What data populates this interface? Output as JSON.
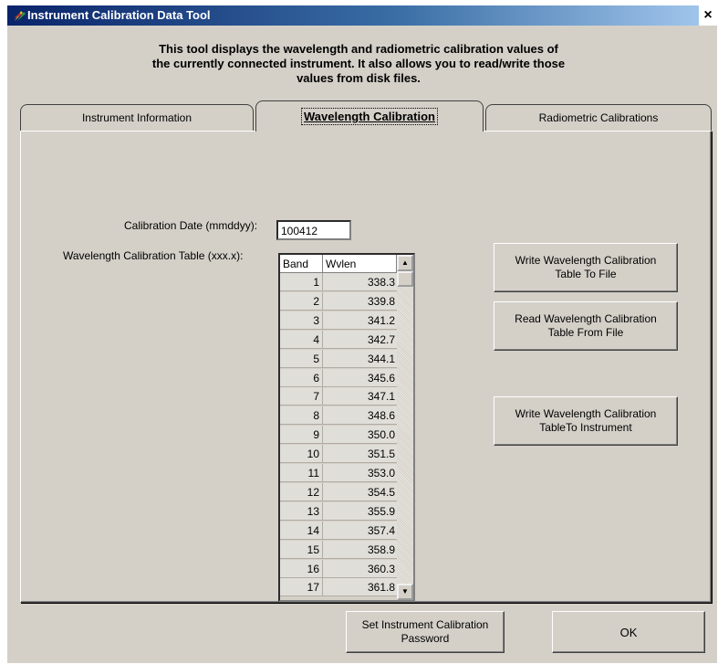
{
  "window": {
    "title": "Instrument Calibration Data Tool",
    "close_glyph": "×"
  },
  "intro": {
    "line1": "This tool displays the wavelength and radiometric calibration values of",
    "line2": "the currently connected instrument. It also allows you to read/write those",
    "line3": "values from disk files."
  },
  "tabs": [
    {
      "label": "Instrument Information",
      "selected": false
    },
    {
      "label": "Wavelength Calibration",
      "selected": true
    },
    {
      "label": "Radiometric Calibrations",
      "selected": false
    }
  ],
  "form": {
    "date_label": "Calibration Date (mmddyy):",
    "date_value": "100412",
    "table_label": "Wavelength Calibration Table (xxx.x):"
  },
  "table": {
    "headers": [
      "Band",
      "Wvlen"
    ],
    "rows": [
      [
        "1",
        "338.3"
      ],
      [
        "2",
        "339.8"
      ],
      [
        "3",
        "341.2"
      ],
      [
        "4",
        "342.7"
      ],
      [
        "5",
        "344.1"
      ],
      [
        "6",
        "345.6"
      ],
      [
        "7",
        "347.1"
      ],
      [
        "8",
        "348.6"
      ],
      [
        "9",
        "350.0"
      ],
      [
        "10",
        "351.5"
      ],
      [
        "11",
        "353.0"
      ],
      [
        "12",
        "354.5"
      ],
      [
        "13",
        "355.9"
      ],
      [
        "14",
        "357.4"
      ],
      [
        "15",
        "358.9"
      ],
      [
        "16",
        "360.3"
      ],
      [
        "17",
        "361.8"
      ]
    ]
  },
  "buttons": {
    "write_file": [
      "Write Wavelength Calibration",
      "Table To File"
    ],
    "read_file": [
      "Read Wavelength Calibration",
      "Table From File"
    ],
    "write_instrument": [
      "Write Wavelength Calibration",
      "TableTo Instrument"
    ],
    "password": [
      "Set Instrument Calibration",
      "Password"
    ],
    "ok": "OK"
  },
  "colors": {
    "face": "#d4d0c8",
    "title_start": "#0a246a",
    "title_end": "#a6caf0"
  }
}
